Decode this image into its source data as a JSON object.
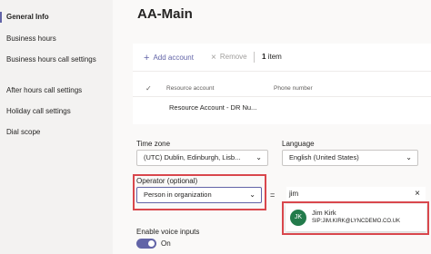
{
  "sidebar": {
    "items": [
      {
        "label": "General Info"
      },
      {
        "label": "Business hours"
      },
      {
        "label": "Business hours call settings"
      },
      {
        "label": "After hours call settings"
      },
      {
        "label": "Holiday call settings"
      },
      {
        "label": "Dial scope"
      }
    ]
  },
  "main": {
    "title": "AA-Main",
    "toolbar": {
      "add_label": "Add account",
      "remove_label": "Remove",
      "count": "1",
      "count_suffix": "item"
    },
    "table": {
      "columns": [
        "Resource account",
        "Phone number"
      ],
      "rows": [
        {
          "resource_account": "Resource Account - DR Nu...",
          "phone_number": ""
        }
      ]
    },
    "time_zone": {
      "label": "Time zone",
      "value": "(UTC) Dublin, Edinburgh, Lisb..."
    },
    "language": {
      "label": "Language",
      "value": "English (United States)"
    },
    "operator": {
      "label": "Operator (optional)",
      "value": "Person in organization",
      "equals": "=",
      "search_value": "jim"
    },
    "suggestion": {
      "initials": "JK",
      "name": "Jim Kirk",
      "sip": "SIP:JIM.KIRK@LYNCDEMO.CO.UK"
    },
    "voice_inputs": {
      "label": "Enable voice inputs",
      "state": "On"
    }
  },
  "colors": {
    "accent": "#6264a7",
    "highlight": "#d9474d",
    "avatar": "#237b4b"
  }
}
